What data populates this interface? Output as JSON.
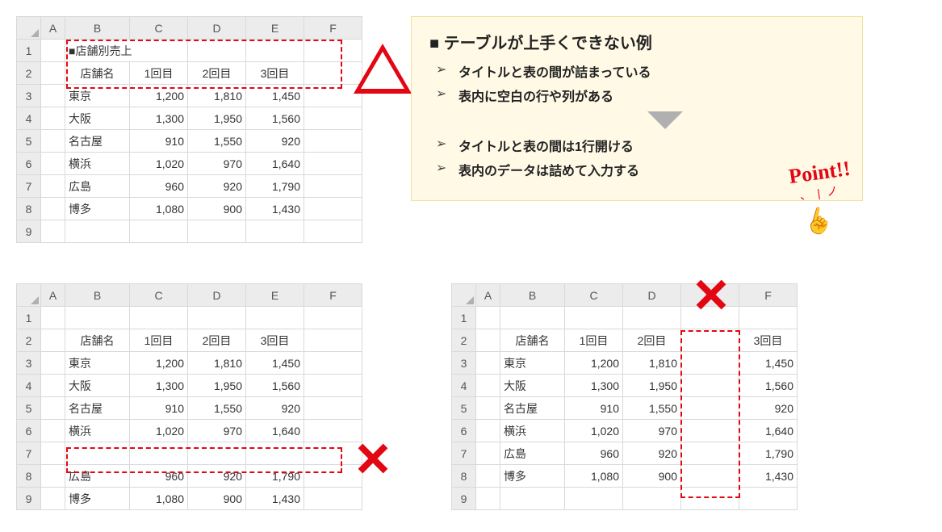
{
  "columns": [
    "A",
    "B",
    "C",
    "D",
    "E",
    "F"
  ],
  "rowNums": [
    "1",
    "2",
    "3",
    "4",
    "5",
    "6",
    "7",
    "8",
    "9"
  ],
  "tableTitle": "■店舗別売上",
  "headers": {
    "store": "店舗名",
    "c1": "1回目",
    "c2": "2回目",
    "c3": "3回目"
  },
  "data": {
    "tokyo": {
      "name": "東京",
      "v1": "1,200",
      "v2": "1,810",
      "v3": "1,450"
    },
    "osaka": {
      "name": "大阪",
      "v1": "1,300",
      "v2": "1,950",
      "v3": "1,560"
    },
    "nagoya": {
      "name": "名古屋",
      "v1": "910",
      "v2": "1,550",
      "v3": "920"
    },
    "yokohama": {
      "name": "横浜",
      "v1": "1,020",
      "v2": "970",
      "v3": "1,640"
    },
    "hiroshima": {
      "name": "広島",
      "v1": "960",
      "v2": "920",
      "v3": "1,790"
    },
    "hakata": {
      "name": "博多",
      "v1": "1,080",
      "v2": "900",
      "v3": "1,430"
    }
  },
  "note": {
    "title": "■ テーブルが上手くできない例",
    "bad1": "タイトルと表の間が詰まっている",
    "bad2": "表内に空白の行や列がある",
    "good1": "タイトルと表の間は1行開ける",
    "good2": "表内のデータは詰めて入力する",
    "point": "Point!!"
  }
}
